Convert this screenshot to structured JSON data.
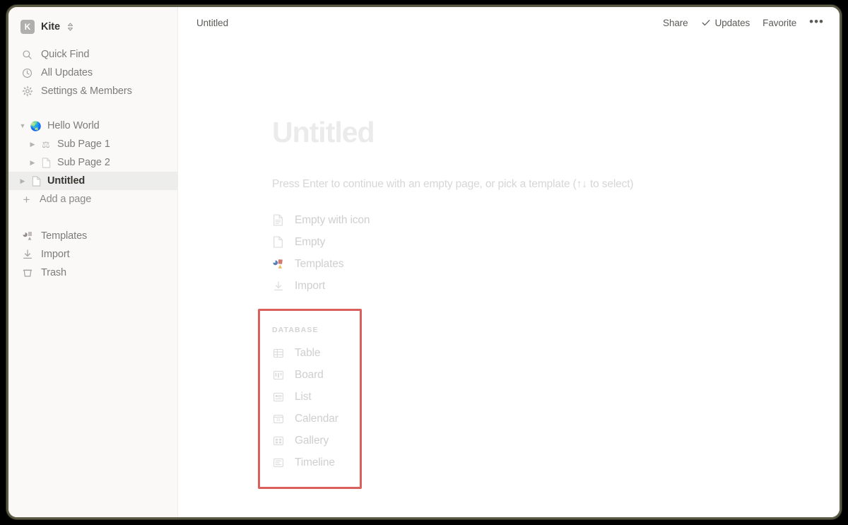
{
  "window": {
    "accent_red": "#d9605c",
    "sidebar_bg": "#faf9f8",
    "selected_bg": "#ededeb"
  },
  "sidebar": {
    "workspace": {
      "badge_letter": "K",
      "name": "Kite",
      "switcher_icon": "chevron-updown-icon"
    },
    "nav": [
      {
        "icon": "search-icon",
        "label": "Quick Find"
      },
      {
        "icon": "clock-icon",
        "label": "All Updates"
      },
      {
        "icon": "gear-icon",
        "label": "Settings & Members"
      }
    ],
    "tree": [
      {
        "label": "Hello World",
        "icon": "globe-emoji",
        "emoji": "🌏",
        "indent": 0,
        "expanded": true,
        "selected": false
      },
      {
        "label": "Sub Page 1",
        "icon": "balance-scale-emoji",
        "emoji": "⚖",
        "indent": 1,
        "expanded": false,
        "selected": false
      },
      {
        "label": "Sub Page 2",
        "icon": "page-icon",
        "emoji": "",
        "indent": 1,
        "expanded": false,
        "selected": false
      },
      {
        "label": "Untitled",
        "icon": "page-icon",
        "emoji": "",
        "indent": 0,
        "expanded": false,
        "selected": true
      }
    ],
    "add_page": {
      "icon": "plus-icon",
      "label": "Add a page"
    },
    "bottom": [
      {
        "icon": "templates-icon",
        "label": "Templates"
      },
      {
        "icon": "import-icon",
        "label": "Import"
      },
      {
        "icon": "trash-icon",
        "label": "Trash"
      }
    ]
  },
  "topbar": {
    "breadcrumb": "Untitled",
    "share_label": "Share",
    "updates_label": "Updates",
    "updates_icon": "check-icon",
    "favorite_label": "Favorite",
    "more_icon": "more-horizontal-icon",
    "more_label": "•••"
  },
  "page": {
    "title": "Untitled",
    "hint": "Press Enter to continue with an empty page, or pick a template (↑↓ to select)",
    "options": [
      {
        "icon": "page-lines-icon",
        "label": "Empty with icon"
      },
      {
        "icon": "page-blank-icon",
        "label": "Empty"
      },
      {
        "icon": "templates-color-icon",
        "label": "Templates"
      },
      {
        "icon": "import-icon",
        "label": "Import"
      }
    ],
    "database": {
      "section_label": "DATABASE",
      "options": [
        {
          "icon": "table-icon",
          "label": "Table"
        },
        {
          "icon": "board-icon",
          "label": "Board"
        },
        {
          "icon": "list-icon",
          "label": "List"
        },
        {
          "icon": "calendar-icon",
          "label": "Calendar"
        },
        {
          "icon": "gallery-icon",
          "label": "Gallery"
        },
        {
          "icon": "timeline-icon",
          "label": "Timeline"
        }
      ]
    }
  }
}
